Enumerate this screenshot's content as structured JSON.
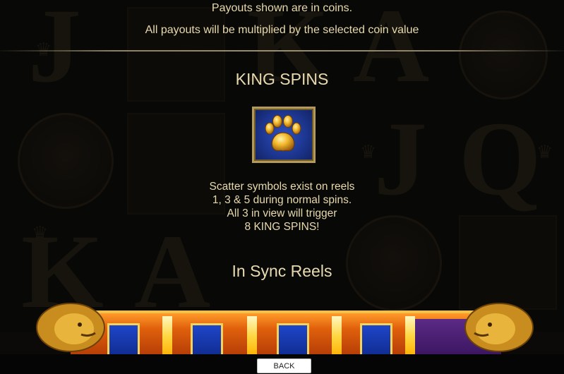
{
  "paytable": {
    "line1": "Payouts shown are in coins.",
    "line2": "All payouts will be multiplied by the selected coin value"
  },
  "king_spins": {
    "title": "KING SPINS",
    "icon": "golden-paw-icon",
    "description": [
      "Scatter symbols exist on reels",
      "1, 3 & 5 during normal spins.",
      "All 3 in view will trigger",
      "8 KING SPINS!"
    ]
  },
  "in_sync": {
    "title": "In Sync Reels"
  },
  "background_symbols": [
    "J",
    "Q",
    "K",
    "A",
    "J",
    "Q",
    "K",
    "A"
  ],
  "footer": {
    "back_label": "BACK"
  },
  "colors": {
    "text": "#e7d9ac",
    "icon_frame": "#b49a58",
    "icon_bg": "#1d3690",
    "strip": "#e0600c"
  }
}
